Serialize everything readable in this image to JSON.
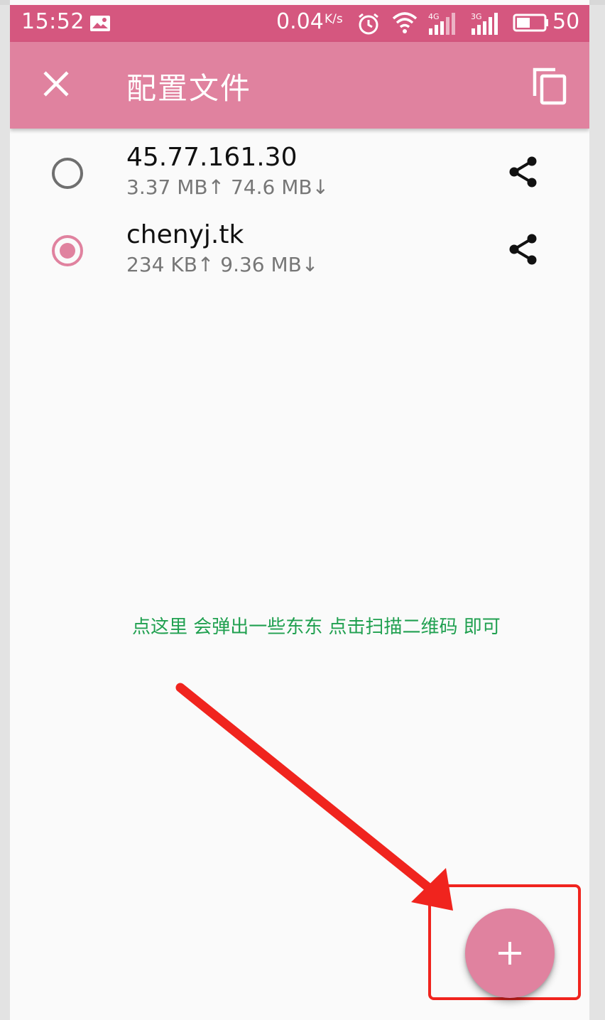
{
  "status_bar": {
    "time": "15:52",
    "net_speed": "0.04",
    "net_speed_unit": "K/s",
    "battery_percent": "50",
    "signal_1_label": "4G",
    "signal_2_label": "3G",
    "icons": [
      "gallery-icon",
      "alarm-icon",
      "wifi-icon",
      "signal-icon",
      "battery-icon"
    ]
  },
  "toolbar": {
    "title": "配置文件",
    "close_icon": "close-icon",
    "copy_icon": "copy-icon"
  },
  "profiles": [
    {
      "name": "45.77.161.30",
      "stats": "3.37 MB↑ 74.6 MB↓",
      "selected": false
    },
    {
      "name": "chenyj.tk",
      "stats": "234 KB↑ 9.36 MB↓",
      "selected": true
    }
  ],
  "annotation": {
    "text": "点这里 会弹出一些东东 点击扫描二维码 即可",
    "color": "#20a050"
  },
  "fab": {
    "icon": "add-icon"
  },
  "colors": {
    "status_bar": "#d5577f",
    "toolbar": "#e0829f",
    "accent": "#e0829f",
    "arrow": "#f0241e",
    "background": "#fafafa"
  }
}
